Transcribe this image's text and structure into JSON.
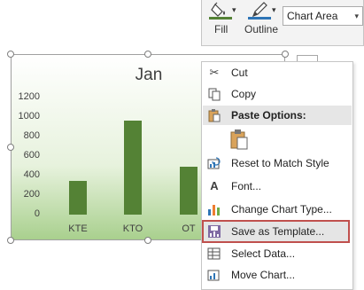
{
  "toolbar": {
    "fill_label": "Fill",
    "outline_label": "Outline",
    "chart_element_value": "Chart Area",
    "fill_color": "#548235",
    "outline_color": "#2e75b6"
  },
  "chart_data": {
    "type": "bar",
    "title": "Jan",
    "categories": [
      "KTE",
      "KTO",
      "OT"
    ],
    "values": [
      350,
      960,
      490
    ],
    "ylim": [
      0,
      1200
    ],
    "yticks": [
      "0",
      "200",
      "400",
      "600",
      "800",
      "1000",
      "1200"
    ],
    "grid": false,
    "bar_color": "#548235"
  },
  "menu": {
    "cut": "Cut",
    "copy": "Copy",
    "paste_header": "Paste Options:",
    "reset": "Reset to Match Style",
    "font": "Font...",
    "change_type": "Change Chart Type...",
    "save_template": "Save as Template...",
    "select_data": "Select Data...",
    "move_chart": "Move Chart..."
  },
  "highlight_color": "#c0504d"
}
